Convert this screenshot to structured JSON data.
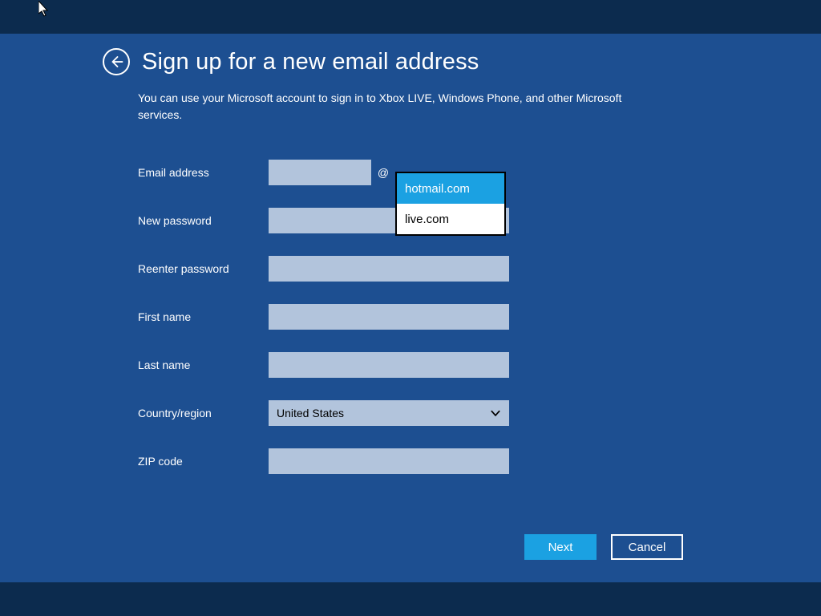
{
  "header": {
    "title": "Sign up for a new email address",
    "subtitle": "You can use your Microsoft account to sign in to Xbox LIVE, Windows Phone, and other Microsoft services."
  },
  "form": {
    "email": {
      "label": "Email address",
      "value": "",
      "at": "@",
      "domain_options": [
        "hotmail.com",
        "live.com"
      ],
      "selected_domain": "hotmail.com"
    },
    "new_password": {
      "label": "New password",
      "value": ""
    },
    "reenter_password": {
      "label": "Reenter password",
      "value": ""
    },
    "first_name": {
      "label": "First name",
      "value": ""
    },
    "last_name": {
      "label": "Last name",
      "value": ""
    },
    "country": {
      "label": "Country/region",
      "value": "United States"
    },
    "zip": {
      "label": "ZIP code",
      "value": ""
    }
  },
  "buttons": {
    "next": "Next",
    "cancel": "Cancel"
  },
  "colors": {
    "page_bg": "#1d4f91",
    "band_bg": "#0c2b4e",
    "input_bg": "#b2c4dc",
    "accent": "#1ba1e2"
  }
}
